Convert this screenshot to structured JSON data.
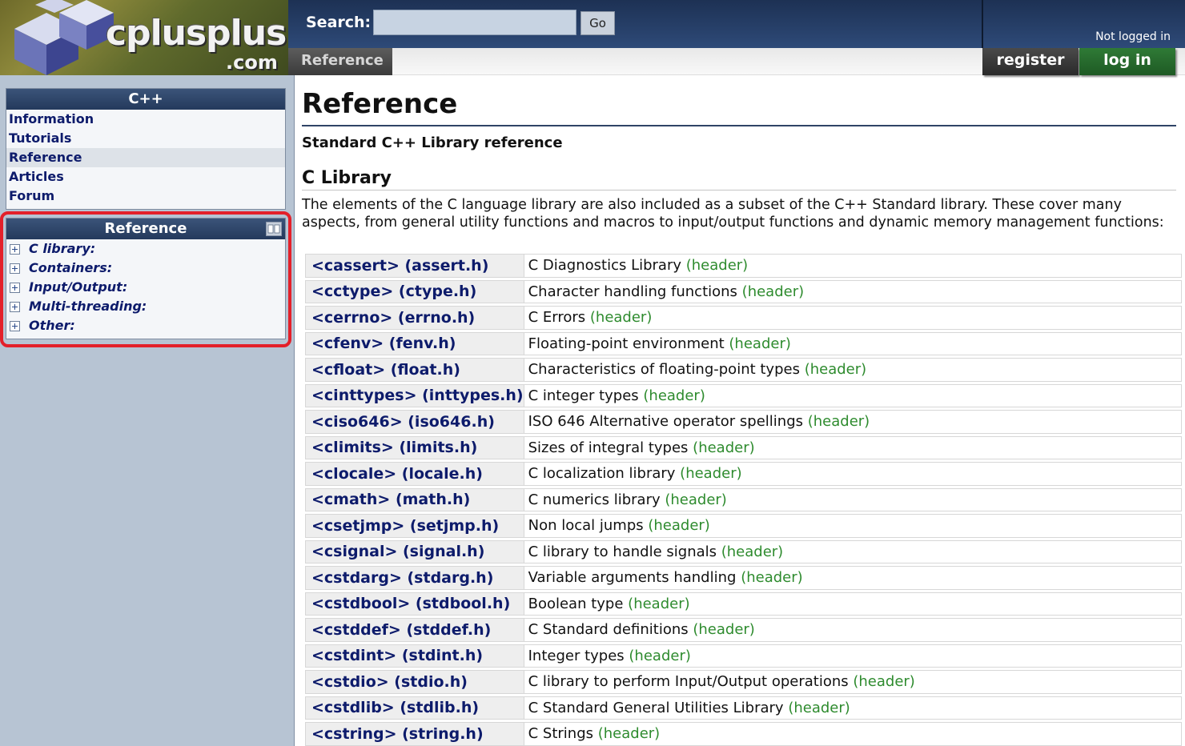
{
  "header": {
    "logo_text": "cplusplus",
    "logo_suffix": ".com",
    "search_label": "Search:",
    "search_value": "",
    "go_label": "Go",
    "login_status": "Not logged in",
    "section_tab": "Reference",
    "register_label": "register",
    "login_label": "log in"
  },
  "sidebar": {
    "cpp_box": {
      "title": "C++",
      "items": [
        {
          "label": "Information",
          "active": false
        },
        {
          "label": "Tutorials",
          "active": false
        },
        {
          "label": "Reference",
          "active": true
        },
        {
          "label": "Articles",
          "active": false
        },
        {
          "label": "Forum",
          "active": false
        }
      ]
    },
    "reference_box": {
      "title": "Reference",
      "icon": "book-icon",
      "items": [
        {
          "label": "C library:"
        },
        {
          "label": "Containers:"
        },
        {
          "label": "Input/Output:"
        },
        {
          "label": "Multi-threading:"
        },
        {
          "label": "Other:"
        }
      ]
    },
    "highlight_color": "#e3202a"
  },
  "main": {
    "title": "Reference",
    "subtitle": "Standard C++ Library reference",
    "section_title": "C Library",
    "section_desc": "The elements of the C language library are also included as a subset of the C++ Standard library. These cover many aspects, from general utility functions and macros to input/output functions and dynamic memory management functions:",
    "kind_label": "(header)",
    "headers": [
      {
        "name": "<cassert> (assert.h)",
        "desc": "C Diagnostics Library"
      },
      {
        "name": "<cctype> (ctype.h)",
        "desc": "Character handling functions"
      },
      {
        "name": "<cerrno> (errno.h)",
        "desc": "C Errors"
      },
      {
        "name": "<cfenv> (fenv.h)",
        "desc": "Floating-point environment"
      },
      {
        "name": "<cfloat> (float.h)",
        "desc": "Characteristics of floating-point types"
      },
      {
        "name": "<cinttypes> (inttypes.h)",
        "desc": "C integer types"
      },
      {
        "name": "<ciso646> (iso646.h)",
        "desc": "ISO 646 Alternative operator spellings"
      },
      {
        "name": "<climits> (limits.h)",
        "desc": "Sizes of integral types"
      },
      {
        "name": "<clocale> (locale.h)",
        "desc": "C localization library"
      },
      {
        "name": "<cmath> (math.h)",
        "desc": "C numerics library"
      },
      {
        "name": "<csetjmp> (setjmp.h)",
        "desc": "Non local jumps"
      },
      {
        "name": "<csignal> (signal.h)",
        "desc": "C library to handle signals"
      },
      {
        "name": "<cstdarg> (stdarg.h)",
        "desc": "Variable arguments handling"
      },
      {
        "name": "<cstdbool> (stdbool.h)",
        "desc": "Boolean type"
      },
      {
        "name": "<cstddef> (stddef.h)",
        "desc": "C Standard definitions"
      },
      {
        "name": "<cstdint> (stdint.h)",
        "desc": "Integer types"
      },
      {
        "name": "<cstdio> (stdio.h)",
        "desc": "C library to perform Input/Output operations"
      },
      {
        "name": "<cstdlib> (stdlib.h)",
        "desc": "C Standard General Utilities Library"
      },
      {
        "name": "<cstring> (string.h)",
        "desc": "C Strings"
      }
    ]
  }
}
